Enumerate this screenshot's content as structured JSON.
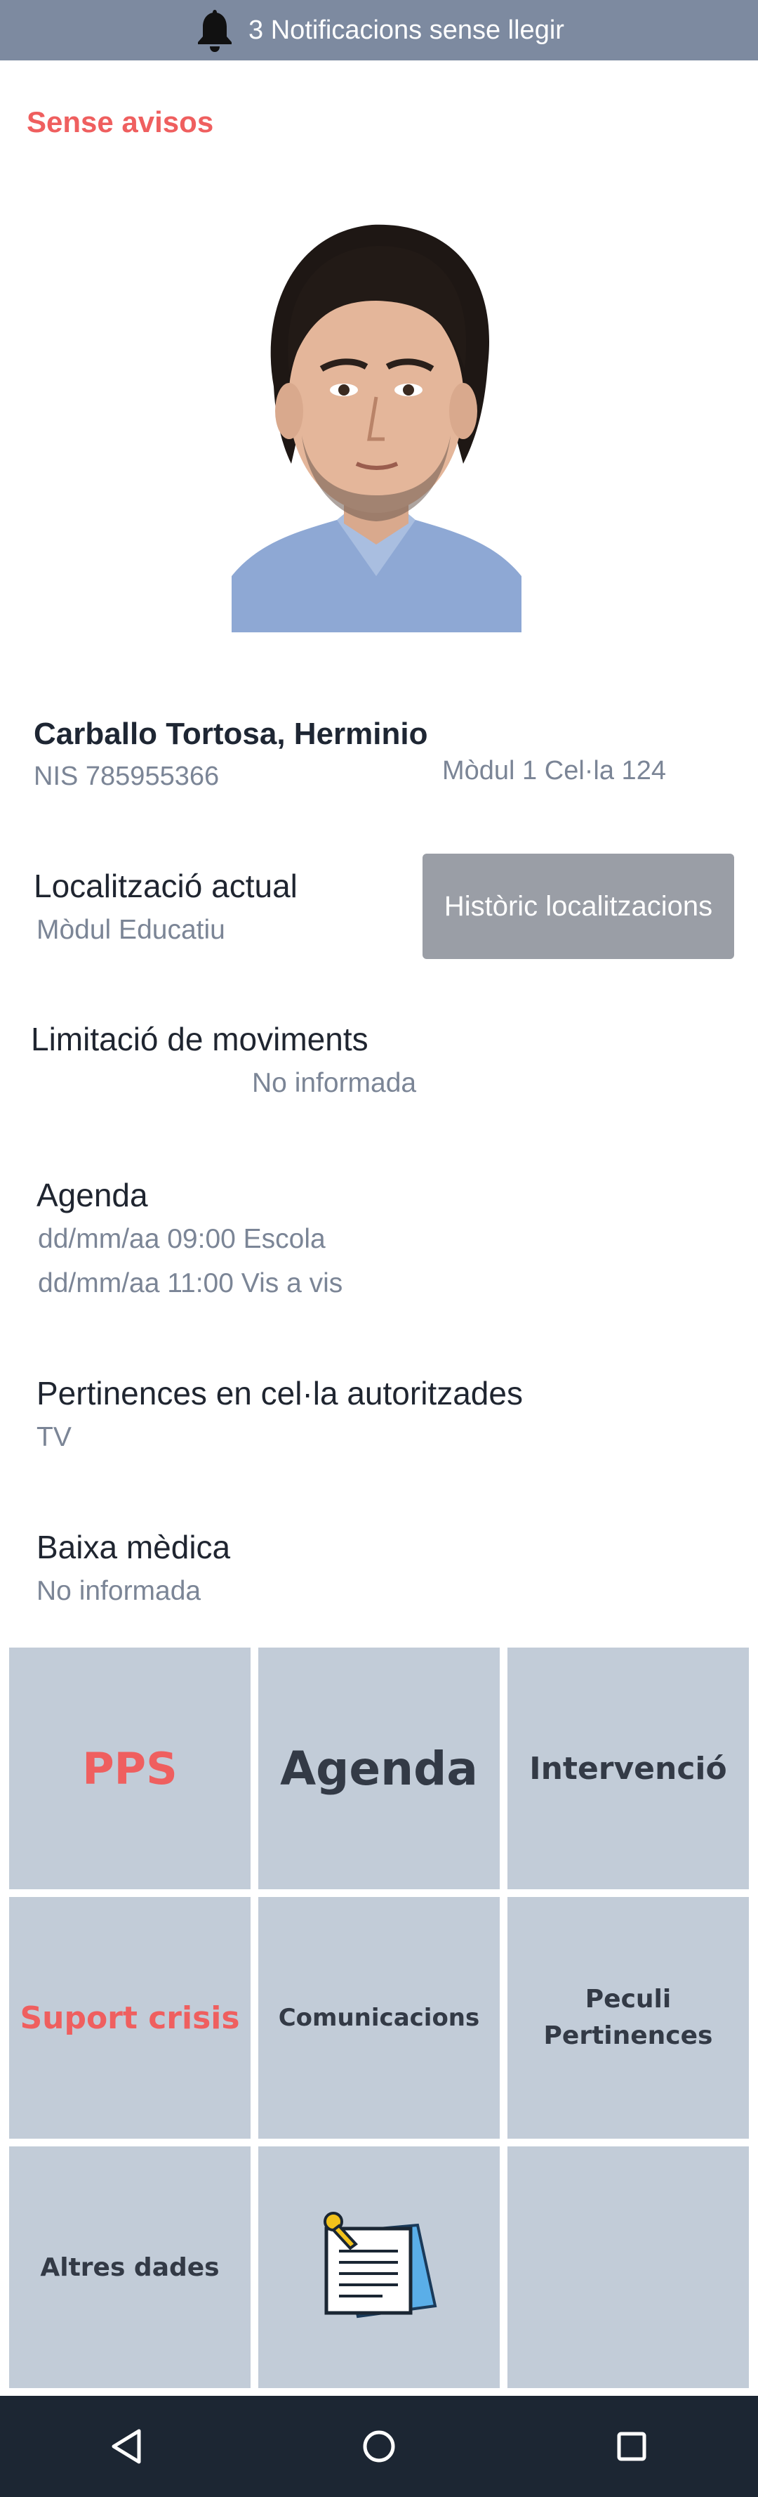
{
  "notifications": {
    "label": "3 Notificacions sense llegir",
    "icon": "bell-icon"
  },
  "status": {
    "warning": "Sense avisos",
    "warning_color": "#ef5f5f"
  },
  "profile": {
    "name": "Carballo Tortosa, Herminio",
    "nis": "NIS 785955366",
    "cell": "Mòdul 1 Cel·la 124"
  },
  "location": {
    "title": "Localització actual",
    "value": "Mòdul Educatiu",
    "history_button": "Històric localitzacions"
  },
  "movement": {
    "title": "Limitació de moviments",
    "value": "No informada"
  },
  "agenda": {
    "title": "Agenda",
    "items": [
      "dd/mm/aa 09:00 Escola",
      "dd/mm/aa 11:00 Vis a vis"
    ]
  },
  "belongings": {
    "title": "Pertinences en cel·la autoritzades",
    "value": "TV"
  },
  "medical": {
    "title": "Baixa mèdica",
    "value": "No informada"
  },
  "menu": {
    "pps": "PPS",
    "agenda": "Agenda",
    "intervencio": "Intervenció",
    "suport": "Suport crisis",
    "comunicacions": "Comunicacions",
    "peculi_line1": "Peculi",
    "peculi_line2": "Pertinences",
    "altres": "Altres dades",
    "notes_icon": "notepad-icon",
    "empty": ""
  },
  "navbar": {
    "icons": [
      "back-icon",
      "home-icon",
      "recents-icon"
    ]
  },
  "colors": {
    "topbar": "#7d8aa0",
    "tile": "#c2ccd8",
    "navbar": "#1c2633",
    "accent_red": "#ef5f5f"
  }
}
